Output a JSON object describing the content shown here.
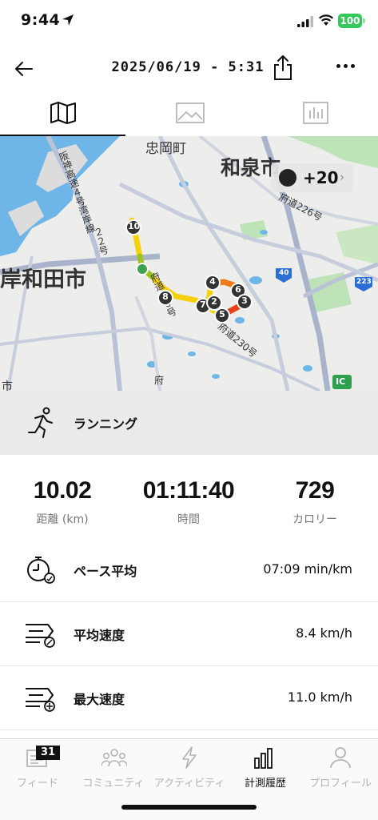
{
  "status": {
    "time": "9:44",
    "battery": "100"
  },
  "header": {
    "title": "2025/06/19 - 5:31"
  },
  "map": {
    "labels": {
      "chuoka": "忠岡町",
      "izumi": "和泉市",
      "kishiwada": "岸和田市",
      "hanshin": "阪神高速４号湾岸線",
      "fudo226": "府道226号",
      "fudo230": "府道230号",
      "fudo30": "府道３０号",
      "route_2": "２２号",
      "route40": "40",
      "route223": "223",
      "ic": "IC",
      "fu_small": "府",
      "ichi_small": "市"
    },
    "badge_text": "+20",
    "markers": [
      "10",
      "8",
      "7",
      "2",
      "4",
      "6",
      "3",
      "5"
    ]
  },
  "activity": {
    "label": "ランニング"
  },
  "summary": {
    "distance": {
      "value": "10.02",
      "label": "距離 (km)"
    },
    "time": {
      "value": "01:11:40",
      "label": "時間"
    },
    "calories": {
      "value": "729",
      "label": "カロリー"
    }
  },
  "stats": [
    {
      "label": "ペース平均",
      "value": "07:09 min/km"
    },
    {
      "label": "平均速度",
      "value": "8.4 km/h"
    },
    {
      "label": "最大速度",
      "value": "11.0 km/h"
    }
  ],
  "nav": {
    "feed": {
      "label": "フィード",
      "badge": "31"
    },
    "community": {
      "label": "コミュニティ"
    },
    "activity": {
      "label": "アクティビティ"
    },
    "tracking": {
      "label": "計測履歴"
    },
    "profile": {
      "label": "プロフィール"
    }
  },
  "colors": {
    "battery": "#34c759",
    "map_water": "#6fb6e8",
    "route_start": "#f5d10b",
    "route_end": "#e8401c"
  }
}
